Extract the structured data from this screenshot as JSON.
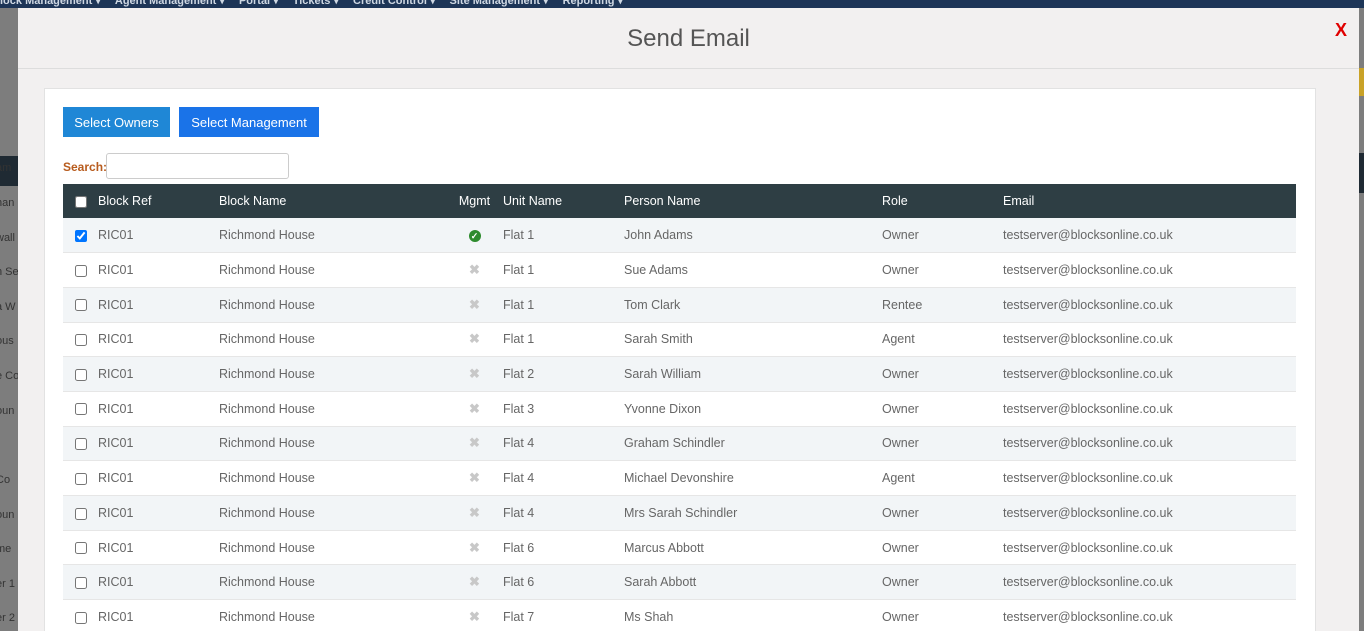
{
  "background_nav": [
    "lock Management ▾",
    "Agent Management ▾",
    "Portal ▾",
    "Tickets ▾",
    "Credit Control ▾",
    "Site Management ▾",
    "Reporting ▾"
  ],
  "background_side": [
    "am",
    "han",
    "wall",
    "n Se",
    "a W",
    "ous",
    "e Co",
    "oun",
    "Co",
    "oun",
    "me",
    "er 1",
    "er 2"
  ],
  "modal": {
    "title": "Send Email",
    "close": "X"
  },
  "buttons": {
    "select_owners": "Select Owners",
    "select_management": "Select Management"
  },
  "search": {
    "label": "Search:",
    "value": ""
  },
  "table": {
    "headers": {
      "block_ref": "Block Ref",
      "block_name": "Block Name",
      "mgmt": "Mgmt",
      "unit_name": "Unit Name",
      "person_name": "Person Name",
      "role": "Role",
      "email": "Email"
    },
    "rows": [
      {
        "checked": true,
        "block_ref": "RIC01",
        "block_name": "Richmond House",
        "mgmt": true,
        "unit_name": "Flat 1",
        "person_name": "John Adams",
        "role": "Owner",
        "email": "testserver@blocksonline.co.uk"
      },
      {
        "checked": false,
        "block_ref": "RIC01",
        "block_name": "Richmond House",
        "mgmt": false,
        "unit_name": "Flat 1",
        "person_name": "Sue Adams",
        "role": "Owner",
        "email": "testserver@blocksonline.co.uk"
      },
      {
        "checked": false,
        "block_ref": "RIC01",
        "block_name": "Richmond House",
        "mgmt": false,
        "unit_name": "Flat 1",
        "person_name": "Tom Clark",
        "role": "Rentee",
        "email": "testserver@blocksonline.co.uk"
      },
      {
        "checked": false,
        "block_ref": "RIC01",
        "block_name": "Richmond House",
        "mgmt": false,
        "unit_name": "Flat 1",
        "person_name": "Sarah Smith",
        "role": "Agent",
        "email": "testserver@blocksonline.co.uk"
      },
      {
        "checked": false,
        "block_ref": "RIC01",
        "block_name": "Richmond House",
        "mgmt": false,
        "unit_name": "Flat 2",
        "person_name": "Sarah William",
        "role": "Owner",
        "email": "testserver@blocksonline.co.uk"
      },
      {
        "checked": false,
        "block_ref": "RIC01",
        "block_name": "Richmond House",
        "mgmt": false,
        "unit_name": "Flat 3",
        "person_name": "Yvonne Dixon",
        "role": "Owner",
        "email": "testserver@blocksonline.co.uk"
      },
      {
        "checked": false,
        "block_ref": "RIC01",
        "block_name": "Richmond House",
        "mgmt": false,
        "unit_name": "Flat 4",
        "person_name": "Graham Schindler",
        "role": "Owner",
        "email": "testserver@blocksonline.co.uk"
      },
      {
        "checked": false,
        "block_ref": "RIC01",
        "block_name": "Richmond House",
        "mgmt": false,
        "unit_name": "Flat 4",
        "person_name": "Michael Devonshire",
        "role": "Agent",
        "email": "testserver@blocksonline.co.uk"
      },
      {
        "checked": false,
        "block_ref": "RIC01",
        "block_name": "Richmond House",
        "mgmt": false,
        "unit_name": "Flat 4",
        "person_name": "Mrs Sarah Schindler",
        "role": "Owner",
        "email": "testserver@blocksonline.co.uk"
      },
      {
        "checked": false,
        "block_ref": "RIC01",
        "block_name": "Richmond House",
        "mgmt": false,
        "unit_name": "Flat 6",
        "person_name": "Marcus Abbott",
        "role": "Owner",
        "email": "testserver@blocksonline.co.uk"
      },
      {
        "checked": false,
        "block_ref": "RIC01",
        "block_name": "Richmond House",
        "mgmt": false,
        "unit_name": "Flat 6",
        "person_name": "Sarah Abbott",
        "role": "Owner",
        "email": "testserver@blocksonline.co.uk"
      },
      {
        "checked": false,
        "block_ref": "RIC01",
        "block_name": "Richmond House",
        "mgmt": false,
        "unit_name": "Flat 7",
        "person_name": "Ms Shah",
        "role": "Owner",
        "email": "testserver@blocksonline.co.uk"
      }
    ]
  },
  "icons": {
    "mgmt_yes": "check-circle-icon",
    "mgmt_no": "x-icon"
  },
  "colors": {
    "header_bg": "#2e3e44",
    "close": "#e00000",
    "btn_owners": "#1f87d6",
    "btn_management": "#1a73e8",
    "search_label": "#b85c1e",
    "check_green": "#2e8b2e"
  }
}
